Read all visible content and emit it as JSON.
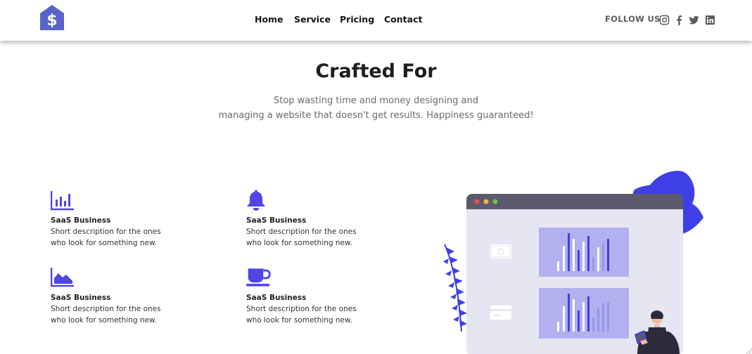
{
  "nav": {
    "logo_icon": "dollar-house-icon",
    "links": [
      "Home",
      "Service",
      "Pricing",
      "Contact"
    ],
    "follow_label": "FOLLOW US",
    "socials": [
      "instagram-icon",
      "facebook-icon",
      "twitter-icon",
      "linkedin-icon"
    ]
  },
  "hero": {
    "title": "Crafted For",
    "subtitle_line1": "Stop wasting time and money designing and",
    "subtitle_line2": "managing a website that doesn't get results. Happiness guaranteed!"
  },
  "features": [
    {
      "icon": "bar-chart-icon",
      "title": "SaaS Business",
      "desc_line1": "Short description for the ones",
      "desc_line2": "who look for something new."
    },
    {
      "icon": "bell-icon",
      "title": "SaaS Business",
      "desc_line1": "Short description for the ones",
      "desc_line2": "who look for something new."
    },
    {
      "icon": "area-chart-icon",
      "title": "SaaS Business",
      "desc_line1": "Short description for the ones",
      "desc_line2": "who look for something new."
    },
    {
      "icon": "coffee-cup-icon",
      "title": "SaaS Business",
      "desc_line1": "Short description for the ones",
      "desc_line2": "who look for something new."
    }
  ],
  "colors": {
    "accent": "#4f46e5",
    "logo": "#5a63c9",
    "window_frame": "#5d5a70",
    "window_body": "#e6e6f2",
    "panel": "#b3b0f0"
  }
}
